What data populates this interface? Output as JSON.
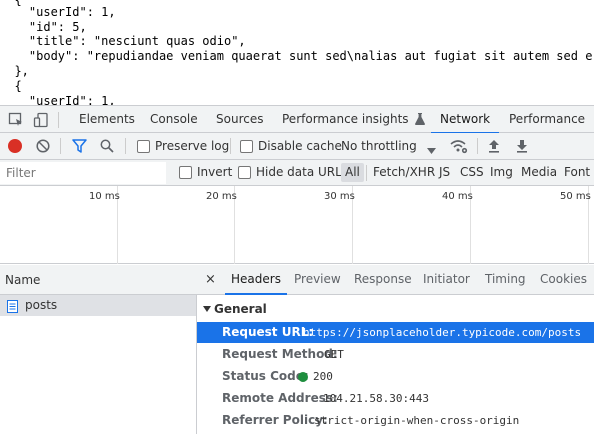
{
  "json_view": {
    "lines": [
      "  {",
      "    \"userId\": 1,",
      "    \"id\": 5,",
      "    \"title\": \"nesciunt quas odio\",",
      "    \"body\": \"repudiandae veniam quaerat sunt sed\\nalias aut fugiat sit autem sed e",
      "  },",
      "  {",
      "    \"userId\": 1,"
    ]
  },
  "devtools": {
    "tabs": [
      "Elements",
      "Console",
      "Sources",
      "Performance insights",
      "Network",
      "Performance"
    ],
    "active_tab": "Network",
    "toolbar": {
      "preserve_log": "Preserve log",
      "disable_cache": "Disable cache",
      "throttling": "No throttling"
    },
    "filter": {
      "placeholder": "Filter",
      "invert": "Invert",
      "hide_data_urls": "Hide data URLs",
      "types": [
        "All",
        "Fetch/XHR",
        "JS",
        "CSS",
        "Img",
        "Media",
        "Font"
      ],
      "active_type": "All"
    },
    "timeline": {
      "ticks": [
        "10 ms",
        "20 ms",
        "30 ms",
        "40 ms",
        "50 ms"
      ]
    },
    "requests": {
      "header": "Name",
      "rows": [
        "posts"
      ]
    },
    "details": {
      "close": "×",
      "tabs": [
        "Headers",
        "Preview",
        "Response",
        "Initiator",
        "Timing",
        "Cookies"
      ],
      "active_tab": "Headers",
      "section": "General",
      "general": [
        {
          "key": "Request URL:",
          "value": "https://jsonplaceholder.typicode.com/posts"
        },
        {
          "key": "Request Method:",
          "value": "GET"
        },
        {
          "key": "Status Code:",
          "value": "200"
        },
        {
          "key": "Remote Address:",
          "value": "104.21.58.30:443"
        },
        {
          "key": "Referrer Policy:",
          "value": "strict-origin-when-cross-origin"
        }
      ],
      "status_color": "#1e8e3e"
    }
  },
  "colors": {
    "accent": "#1a73e8",
    "record": "#d93025"
  }
}
